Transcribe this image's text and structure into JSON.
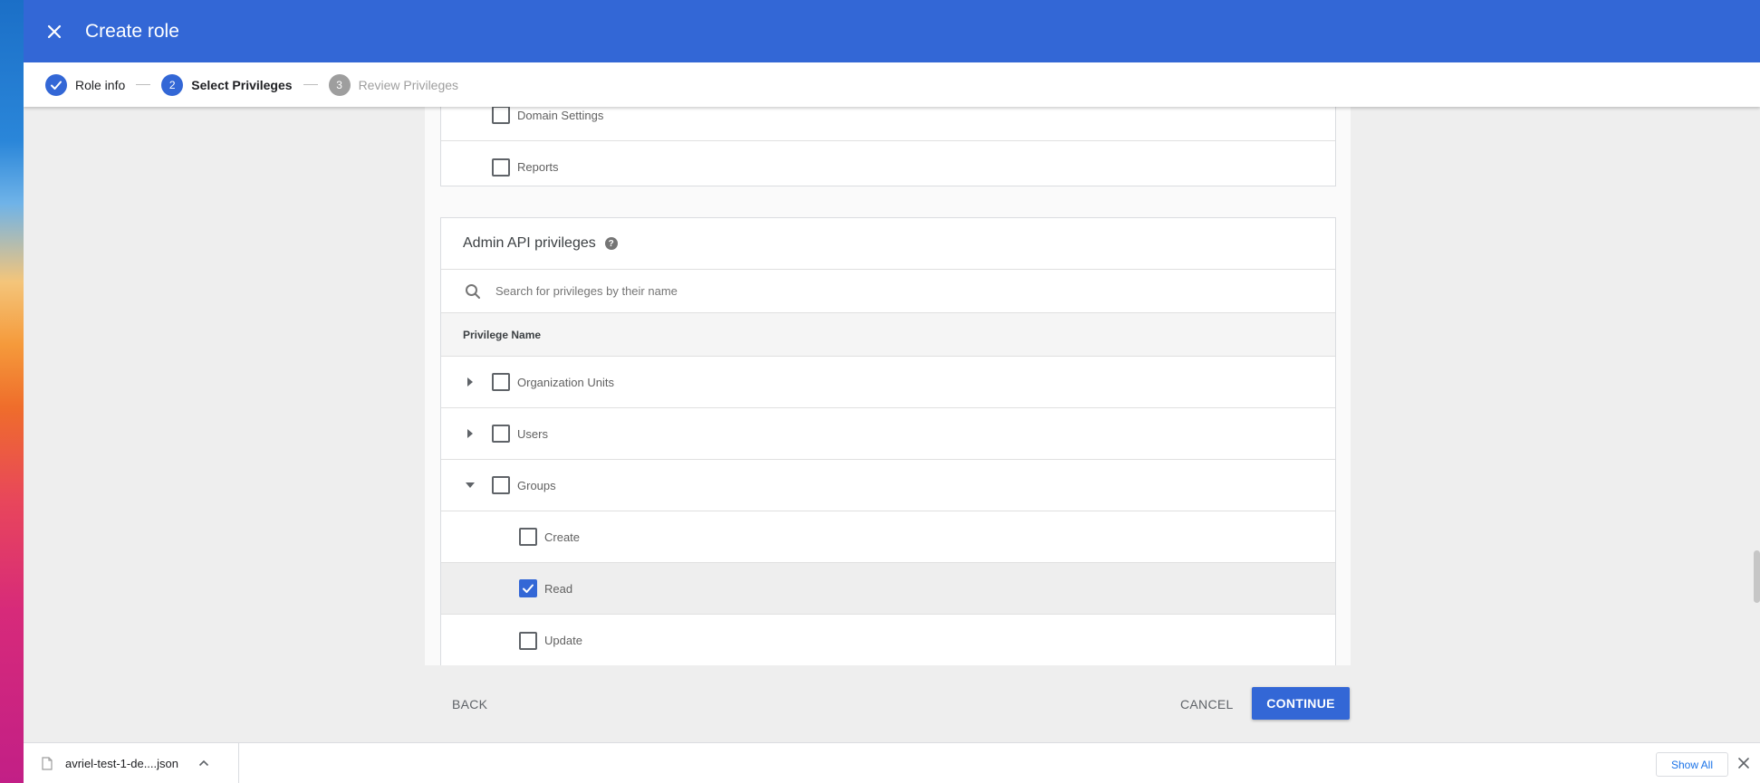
{
  "header": {
    "title": "Create role"
  },
  "stepper": {
    "steps": [
      {
        "label": "Role info",
        "number": "1",
        "state": "done"
      },
      {
        "label": "Select Privileges",
        "number": "2",
        "state": "active"
      },
      {
        "label": "Review Privileges",
        "number": "3",
        "state": "pending"
      }
    ]
  },
  "console_privileges": {
    "items": [
      {
        "label": "Domain Settings",
        "checked": false
      },
      {
        "label": "Reports",
        "checked": false
      }
    ]
  },
  "admin_api": {
    "title": "Admin API privileges",
    "search_placeholder": "Search for privileges by their name",
    "column_header": "Privilege Name",
    "items": [
      {
        "label": "Organization Units",
        "checked": false,
        "expanded": false
      },
      {
        "label": "Users",
        "checked": false,
        "expanded": false
      },
      {
        "label": "Groups",
        "checked": false,
        "expanded": true
      },
      {
        "label": "Create",
        "checked": false
      },
      {
        "label": "Read",
        "checked": true
      },
      {
        "label": "Update",
        "checked": false
      }
    ]
  },
  "actions": {
    "back": "BACK",
    "cancel": "CANCEL",
    "continue": "CONTINUE"
  },
  "download_bar": {
    "file_name": "avriel-test-1-de....json",
    "show_all": "Show All"
  },
  "colors": {
    "accent": "#3367d6",
    "header_bg": "#3367d6"
  }
}
